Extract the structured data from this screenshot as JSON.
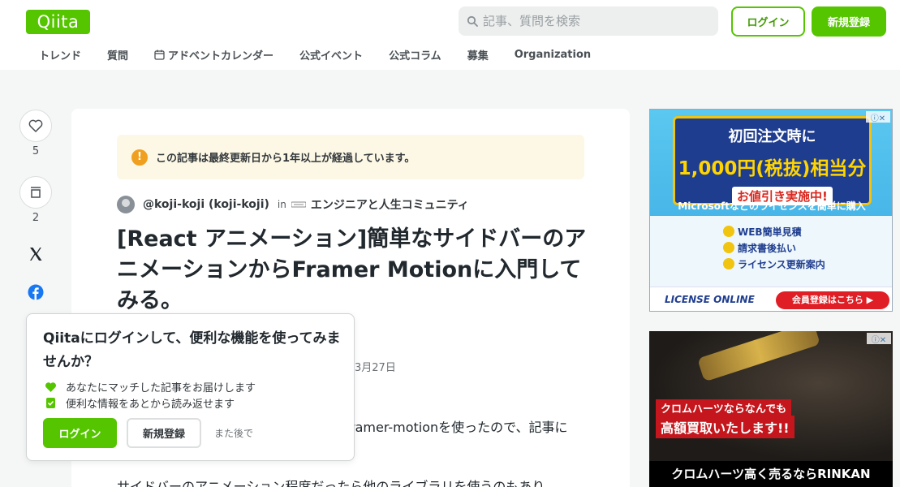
{
  "header": {
    "logo": "Qiita",
    "search_placeholder": "記事、質問を検索",
    "login_label": "ログイン",
    "signup_label": "新規登録"
  },
  "nav": {
    "items": [
      "トレンド",
      "質問",
      "アドベントカレンダー",
      "公式イベント",
      "公式コラム",
      "募集",
      "Organization"
    ]
  },
  "actions": {
    "like_count": "5",
    "stock_count": "2"
  },
  "article": {
    "notice": "この記事は最終更新日から1年以上が経過しています。",
    "author": "@koji-koji (koji-koji)",
    "in_label": "in",
    "organization": "エンジニアと人生コミュニティ",
    "title": "[React アニメーション]簡単なサイドバーのアニメーションからFramer Motionに入門してみる。",
    "date_fragment": "3月27日",
    "body_line1": "ramer-motionを使ったので、記事に",
    "body_line2": "サイドバーのアニメーション程度だったら他のライブラリを使うのもあり"
  },
  "login_popup": {
    "title": "Qiitaにログインして、便利な機能を使ってみませんか？",
    "feature1": "あなたにマッチした記事をお届けします",
    "feature2": "便利な情報をあとから読み返せます",
    "login_label": "ログイン",
    "signup_label": "新規登録",
    "later_label": "また後で"
  },
  "ad1": {
    "line1": "初回注文時に",
    "line2": "1,000円(税抜)相当分",
    "line3": "お値引き実施中!",
    "sub": "Microsoftなどのライセンスを簡単に購入",
    "features": [
      "WEB簡単見積",
      "請求書後払い",
      "ライセンス更新案内"
    ],
    "brand": "LICENSE ONLINE",
    "cta": "会員登録はこちら ▶"
  },
  "ad2": {
    "line1": "クロムハーツならなんでも",
    "line2": "高額買取いたします!!",
    "bar": "クロムハーツ高く売るならRINKAN"
  },
  "colors": {
    "brand": "#55c500",
    "notice_bg": "#fdf8e5",
    "warning": "#f0a020"
  }
}
